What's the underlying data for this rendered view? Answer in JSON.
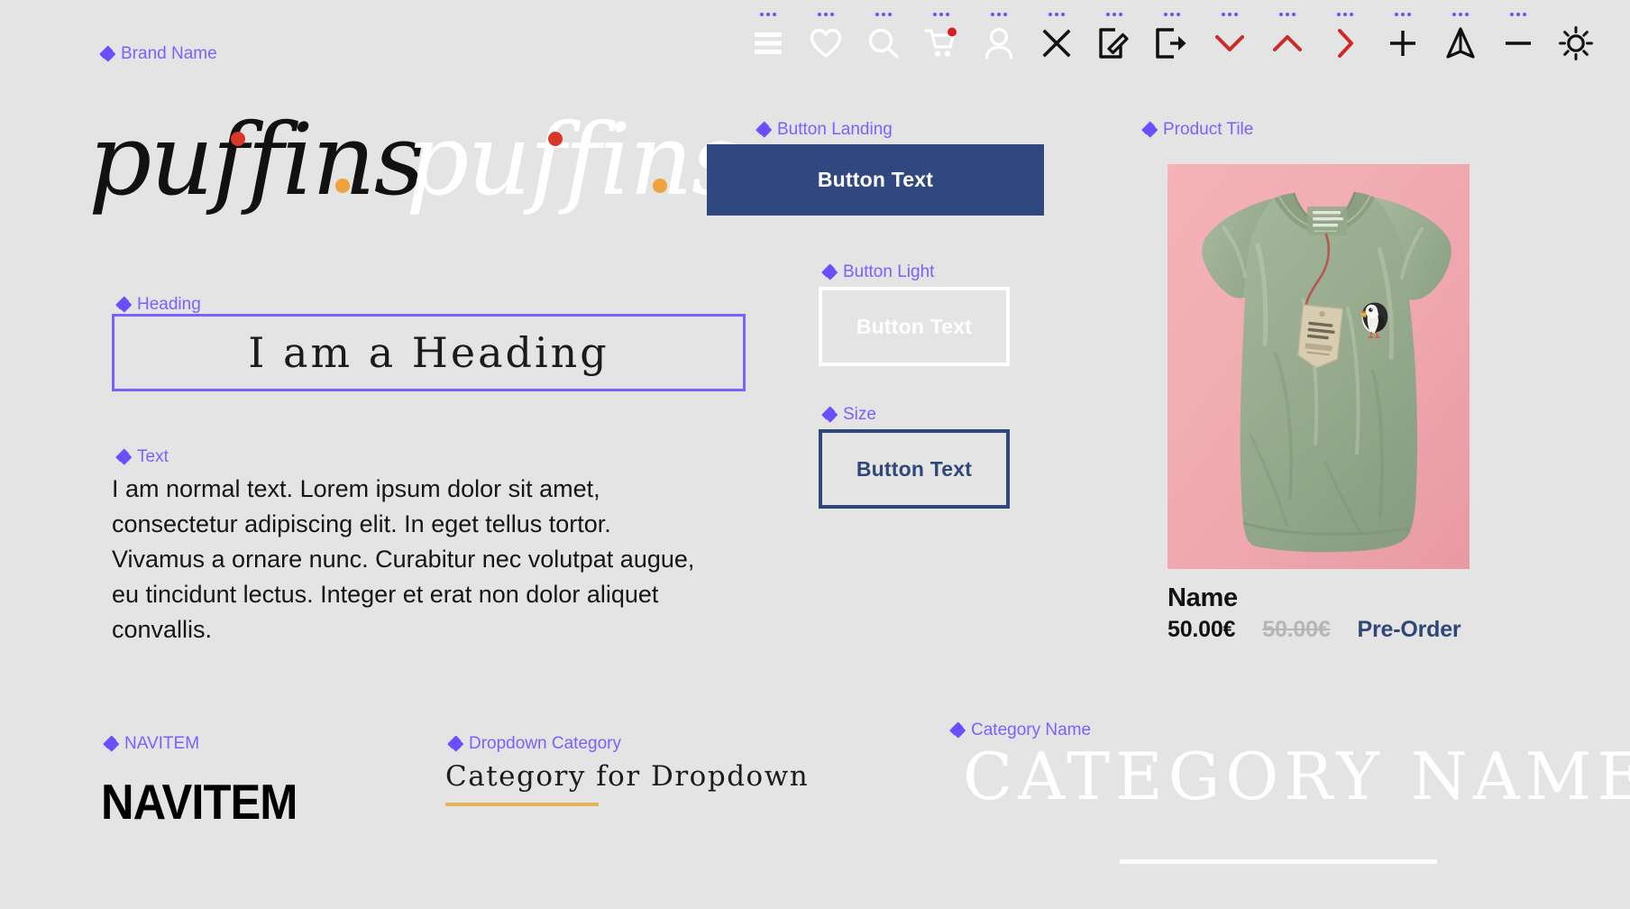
{
  "canvas": {
    "background_color": "#e4e4e4",
    "component_marker_color": "#7b61ff"
  },
  "sections": {
    "brand_name": {
      "label": "Brand Name"
    },
    "button_landing": {
      "label": "Button Landing",
      "button_text": "Button Text",
      "fill_color": "#31477f",
      "text_color": "#ffffff"
    },
    "button_light": {
      "label": "Button Light",
      "button_text": "Button Text",
      "border_color": "#ffffff",
      "text_color": "#ffffff"
    },
    "size": {
      "label": "Size",
      "button_text": "Button Text",
      "border_color": "#2f4878",
      "text_color": "#2f4878"
    },
    "product_tile": {
      "label": "Product Tile"
    },
    "heading": {
      "label": "Heading",
      "text": "I am a Heading",
      "frame_color": "#7b61ff"
    },
    "text": {
      "label": "Text",
      "body": "I am normal text. Lorem ipsum dolor sit amet, consectetur adipiscing elit. In eget tellus tortor. Vivamus a ornare nunc. Curabitur nec volutpat augue, eu tincidunt lectus. Integer et erat non dolor aliquet convallis."
    },
    "navitem": {
      "label": "NAVITEM",
      "text": "NAVITEM"
    },
    "dropdown_category": {
      "label": "Dropdown Category",
      "text": "Category for Dropdown",
      "rule_color": "#e8b258"
    },
    "category_name": {
      "label": "Category Name",
      "text": "CATEGORY NAME",
      "text_color": "#ffffff",
      "rule_color": "#ffffff"
    }
  },
  "logos": [
    {
      "id": "logo-dark",
      "wordmark": "puffins",
      "color": "#111111",
      "accent_dot_color": "#d8372c",
      "period_dot_color": "#eda23e"
    },
    {
      "id": "logo-light",
      "wordmark": "puffins",
      "color": "#ffffff",
      "accent_dot_color": "#d8372c",
      "period_dot_color": "#eda23e"
    }
  ],
  "icon_bar": {
    "marker_glyph": "...",
    "icons": [
      {
        "name": "hamburger-menu-icon",
        "color": "#ffffff",
        "badge": false
      },
      {
        "name": "heart-icon",
        "color": "#ffffff",
        "badge": false
      },
      {
        "name": "search-icon",
        "color": "#ffffff",
        "badge": false
      },
      {
        "name": "shopping-cart-icon",
        "color": "#ffffff",
        "badge": true,
        "badge_color": "#cf2222"
      },
      {
        "name": "user-account-icon",
        "color": "#ffffff",
        "badge": false
      },
      {
        "name": "close-x-icon",
        "color": "#111111",
        "badge": false
      },
      {
        "name": "edit-pencil-icon",
        "color": "#111111",
        "badge": false
      },
      {
        "name": "logout-icon",
        "color": "#111111",
        "badge": false
      },
      {
        "name": "chevron-down-icon",
        "color": "#cf2a2a",
        "badge": false
      },
      {
        "name": "chevron-up-icon",
        "color": "#cf2a2a",
        "badge": false
      },
      {
        "name": "chevron-right-icon",
        "color": "#cf2a2a",
        "badge": false
      },
      {
        "name": "plus-icon",
        "color": "#111111",
        "badge": false
      },
      {
        "name": "send-paper-plane-icon",
        "color": "#111111",
        "badge": false
      },
      {
        "name": "minus-icon",
        "color": "#111111",
        "badge": false
      },
      {
        "name": "brightness-sun-icon",
        "color": "#111111",
        "badge": false
      }
    ]
  },
  "product": {
    "name": "Name",
    "price": "50.00€",
    "old_price": "50.00€",
    "status": "Pre-Order",
    "image": {
      "description": "sage green v-neck t-shirt with hang tag and puffin embroidery on pink background",
      "background_color": "#f2aeb4",
      "shirt_color": "#9aae92"
    }
  }
}
